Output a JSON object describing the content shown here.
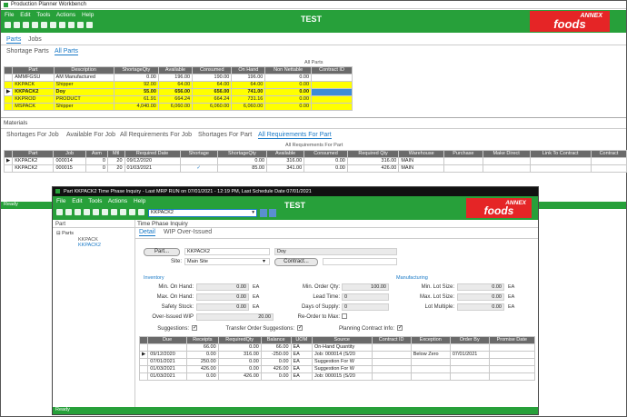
{
  "main": {
    "title": "Production Planner Workbench",
    "center_title": "TEST",
    "menu": [
      "File",
      "Edit",
      "Tools",
      "Actions",
      "Help"
    ],
    "logo_top": "ANNEX",
    "logo_bottom": "foods",
    "top_tabs": [
      "Parts",
      "Jobs"
    ],
    "sub_tabs": [
      "Shortage Parts",
      "All Parts"
    ],
    "parts_section_title": "All Parts",
    "parts_headers": [
      "Part",
      "Description",
      "ShortageQty",
      "Available",
      "Consumed",
      "On Hand",
      "Non Nettable",
      "Contract ID"
    ],
    "parts_rows": [
      [
        "AMMFGSU",
        "AM Manufactured",
        "0.00",
        "196.00",
        "190.00",
        "196.00",
        "0.00",
        ""
      ],
      [
        "KKPACK",
        "Shipper",
        "92.00",
        "64.00",
        "64.00",
        "64.00",
        "0.00",
        ""
      ],
      [
        "KKPACK2",
        "Doy",
        "55.00",
        "656.00",
        "656.00",
        "741.00",
        "0.00",
        ""
      ],
      [
        "KKPROD",
        "PRODUCT",
        "61.91",
        "664.24",
        "664.24",
        "731.16",
        "0.00",
        ""
      ],
      [
        "MSPACK",
        "Shipper",
        "4,040.00",
        "6,060.00",
        "6,060.00",
        "6,060.00",
        "0.00",
        ""
      ]
    ],
    "materials_label": "Materials",
    "mat_tabs": [
      "Shortages For Job",
      "Available For Job",
      "All Requirements For Job",
      "Shortages For Part",
      "All Requirements For Part"
    ],
    "mat_section_title": "All Requirements For Part",
    "mat_headers": [
      "Part",
      "Job",
      "Asm",
      "Mtl",
      "Required Date",
      "Shortage",
      "ShortageQty",
      "Available",
      "Consumed",
      "Required Qty",
      "Warehouse",
      "Purchase",
      "Make Direct",
      "Link To Contract",
      "Contract"
    ],
    "mat_rows": [
      [
        "KKPACK2",
        "000014",
        "0",
        "20",
        "09/12/2020",
        "",
        "0.00",
        "316.00",
        "0.00",
        "316.00",
        "MAIN",
        "",
        "",
        "",
        ""
      ],
      [
        "KKPACK2",
        "000015",
        "0",
        "20",
        "01/03/2021",
        "✓",
        "85.00",
        "341.00",
        "0.00",
        "426.00",
        "MAIN",
        "",
        "",
        "",
        ""
      ]
    ],
    "status": "Ready"
  },
  "popup": {
    "title": "Part KKPACK2 Time Phase Inquiry  - Last MRP RUN on 07/01/2021 - 12:19 PM, Last Schedule Date  07/01/2021",
    "center_title": "TEST",
    "menu": [
      "File",
      "Edit",
      "Tools",
      "Actions",
      "Help"
    ],
    "part_combo": "KKPACK2",
    "logo_top": "ANNEX",
    "logo_bottom": "foods",
    "tree_label": "Part",
    "tree_root": "Parts",
    "tree_items": [
      "KKPACK",
      "KKPACK2"
    ],
    "section_title": "Time Phase Inquiry",
    "tabs": [
      "Detail",
      "WIP Over-Issued"
    ],
    "part_button": "Part...",
    "part_value": "KKPACK2",
    "part_desc": "Doy",
    "site_label": "Site:",
    "site_value": "Main Site",
    "contract_button": "Contract...",
    "inventory_label": "Inventory",
    "manufacturing_label": "Manufacturing",
    "fields": {
      "min_on_hand": {
        "label": "Min. On Hand:",
        "value": "0.00",
        "unit": "EA"
      },
      "max_on_hand": {
        "label": "Max. On Hand:",
        "value": "0.00",
        "unit": "EA"
      },
      "safety_stock": {
        "label": "Safety Stock:",
        "value": "0.00",
        "unit": "EA"
      },
      "over_issued": {
        "label": "Over-Issued WIP",
        "value": "20.00"
      },
      "min_order": {
        "label": "Min. Order Qty:",
        "value": "100.00"
      },
      "lead_time": {
        "label": "Lead Time:",
        "value": "0"
      },
      "days_supply": {
        "label": "Days of Supply:",
        "value": "0"
      },
      "reorder": {
        "label": "Re-Order to Max:"
      },
      "min_lot": {
        "label": "Min. Lot Size:",
        "value": "0.00",
        "unit": "EA"
      },
      "max_lot": {
        "label": "Max. Lot Size:",
        "value": "0.00",
        "unit": "EA"
      },
      "lot_multiple": {
        "label": "Lot Multiple:",
        "value": "0.00",
        "unit": "EA"
      }
    },
    "checks": {
      "suggestions": "Suggestions:",
      "transfer": "Transfer Order Suggestions:",
      "planning": "Planning Contract Info:"
    },
    "grid_headers": [
      "Due",
      "Receipts",
      "RequiredQty",
      "Balance",
      "UOM",
      "Source",
      "Contract ID",
      "Exception",
      "Order By",
      "Promise Date"
    ],
    "grid_rows": [
      [
        "",
        "66.00",
        "0.00",
        "66.00",
        "EA",
        "On-Hand Quantity",
        "",
        "",
        "",
        ""
      ],
      [
        "09/12/2020",
        "0.00",
        "316.00",
        "-250.00",
        "EA",
        "Job: 000014 (S/20",
        "",
        "Below Zero",
        "07/01/2021",
        ""
      ],
      [
        "07/01/2021",
        "250.00",
        "0.00",
        "0.00",
        "EA",
        "Suggestion For W",
        "",
        "",
        "",
        ""
      ],
      [
        "01/03/2021",
        "426.00",
        "0.00",
        "426.00",
        "EA",
        "Suggestion For W",
        "",
        "",
        "",
        ""
      ],
      [
        "01/03/2021",
        "0.00",
        "426.00",
        "0.00",
        "EA",
        "Job: 000015 (S/20",
        "",
        "",
        "",
        ""
      ]
    ],
    "status": "Ready"
  },
  "colors": {
    "green": "#27a03a",
    "selection": "#3d8bd6",
    "highlight": "#ffff00",
    "logo": "#e52526"
  }
}
